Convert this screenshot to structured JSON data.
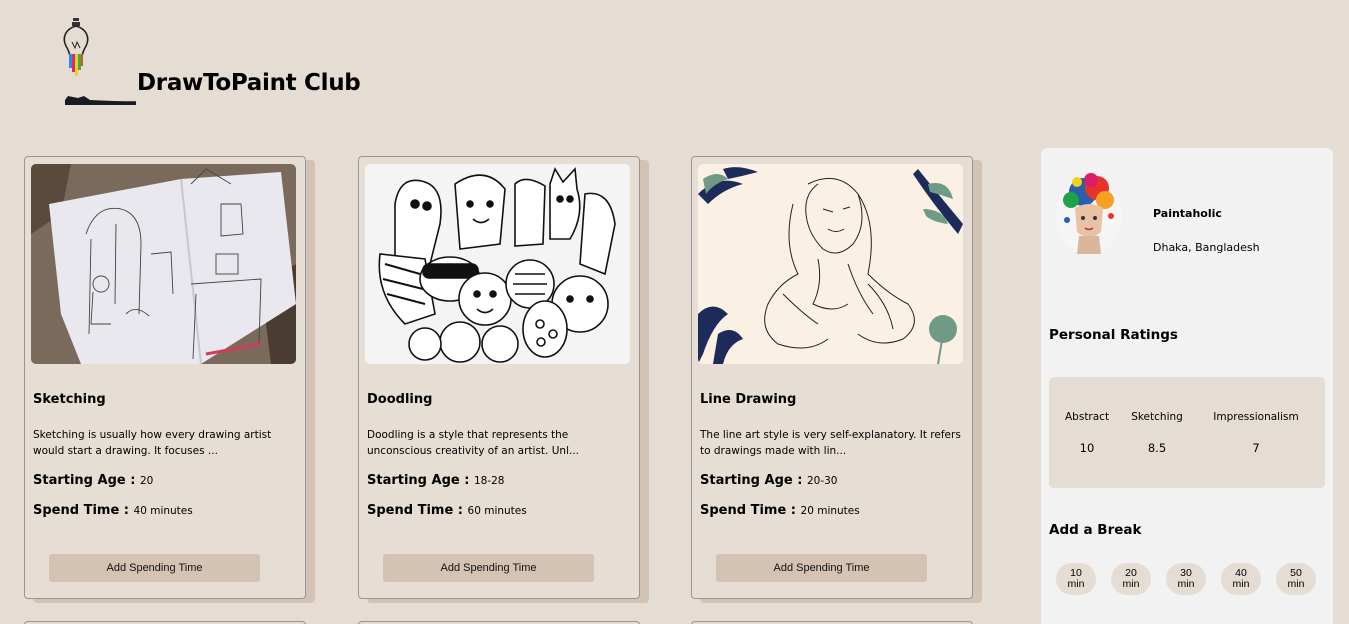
{
  "header": {
    "brand": "DrawToPaint Club"
  },
  "cards": [
    {
      "title": "Sketching",
      "description": "Sketching is usually how every drawing artist would start a drawing. It focuses ...",
      "age_label": "Starting Age :",
      "age": "20",
      "spend_label": "Spend Time :",
      "spend": "40 minutes",
      "button": "Add Spending Time"
    },
    {
      "title": "Doodling",
      "description": "Doodling is a style that represents the unconscious creativity of an artist. Unl...",
      "age_label": "Starting Age :",
      "age": "18-28",
      "spend_label": "Spend Time :",
      "spend": "60 minutes",
      "button": "Add Spending Time"
    },
    {
      "title": "Line Drawing",
      "description": "The line art style is very self-explanatory. It refers to drawings made with lin...",
      "age_label": "Starting Age :",
      "age": "20-30",
      "spend_label": "Spend Time :",
      "spend": "20 minutes",
      "button": "Add Spending Time"
    }
  ],
  "profile": {
    "name": "Paintaholic",
    "location": "Dhaka, Bangladesh"
  },
  "ratings": {
    "title": "Personal Ratings",
    "items": [
      {
        "label": "Abstract",
        "value": "10"
      },
      {
        "label": "Sketching",
        "value": "8.5"
      },
      {
        "label": "Impressionalism",
        "value": "7"
      }
    ]
  },
  "breaks": {
    "title": "Add a Break",
    "items": [
      {
        "num": "10",
        "unit": "min"
      },
      {
        "num": "20",
        "unit": "min"
      },
      {
        "num": "30",
        "unit": "min"
      },
      {
        "num": "40",
        "unit": "min"
      },
      {
        "num": "50",
        "unit": "min"
      }
    ]
  },
  "colors": {
    "background": "#e5ddd4",
    "sidebar": "#f2f2f2",
    "button": "#d4c2b2",
    "card_shadow": "#d2c3b5"
  }
}
